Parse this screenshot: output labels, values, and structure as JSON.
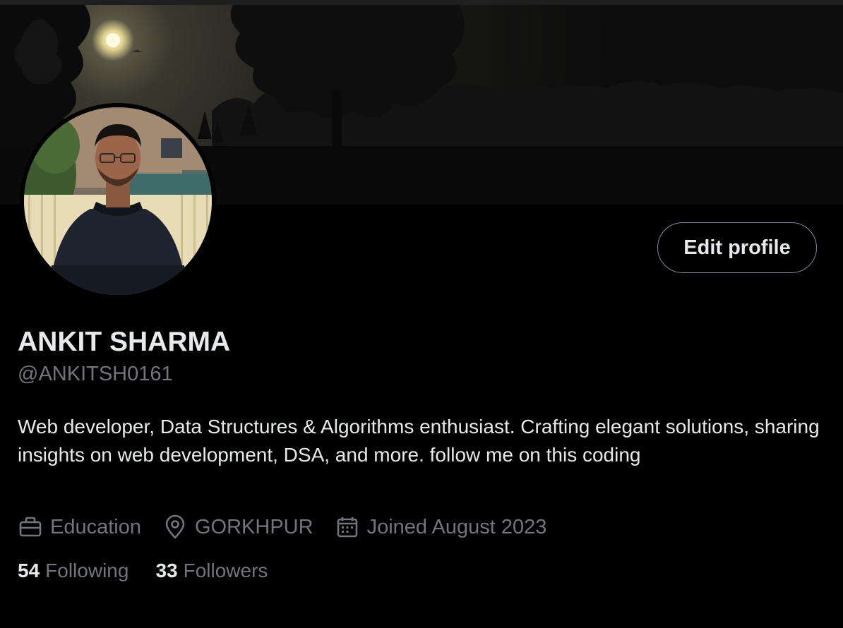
{
  "profile": {
    "display_name": "ANKIT SHARMA",
    "handle": "@ANKITSH0161",
    "bio": "Web developer, Data Structures & Algorithms enthusiast. Crafting elegant solutions, sharing insights on web development, DSA, and more. follow me on this coding",
    "category": "Education",
    "location": "GORKHPUR",
    "joined": "Joined August 2023"
  },
  "actions": {
    "edit_profile_label": "Edit profile"
  },
  "stats": {
    "following_count": "54",
    "following_label": "Following",
    "followers_count": "33",
    "followers_label": "Followers"
  },
  "icons": {
    "category": "briefcase-icon",
    "location": "location-pin-icon",
    "joined": "calendar-icon"
  },
  "colors": {
    "background": "#000000",
    "primary_text": "#e7e9ea",
    "secondary_text": "#71767b",
    "button_border": "#7d8a96"
  }
}
